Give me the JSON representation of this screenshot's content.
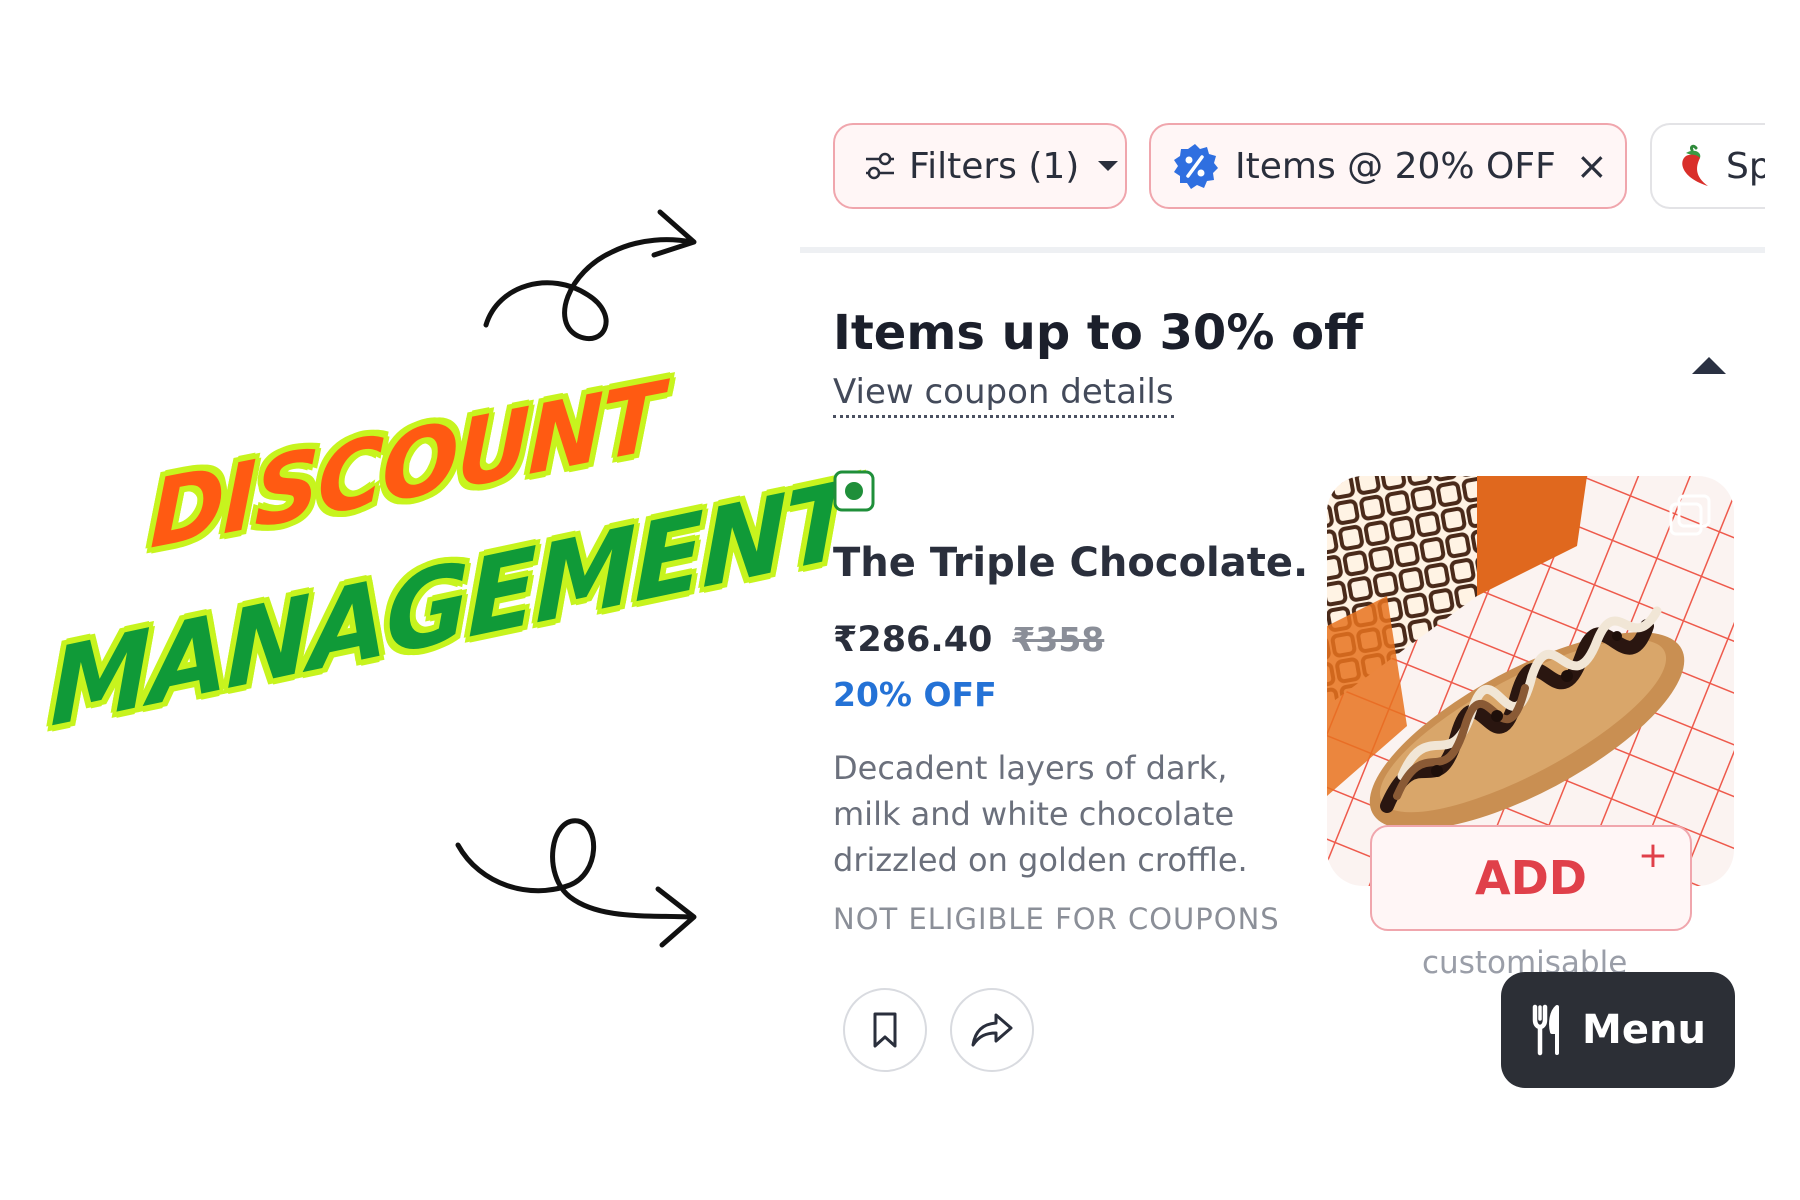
{
  "promo": {
    "line1": "DISCOUNT",
    "line2": "MANAGEMENT"
  },
  "filters": {
    "filters_label": "Filters (1)",
    "offer_label": "Items @ 20% OFF",
    "offer_close": "×",
    "third_label": "Sp"
  },
  "section": {
    "title": "Items up to 30% off",
    "coupon_link": "View coupon details"
  },
  "item": {
    "name": "The Triple Chocolate.",
    "price": "₹286.40",
    "mrp": "₹358",
    "discount": "20% OFF",
    "description": "Decadent layers of dark, milk and white chocolate drizzled on golden croffle.",
    "eligibility": "NOT ELIGIBLE FOR COUPONS",
    "add_label": "ADD",
    "add_plus": "+",
    "customisable": "customisable"
  },
  "menu_button": {
    "label": "Menu"
  },
  "icons": {
    "filters": "sliders-icon",
    "dropdown": "caret-down-icon",
    "offer": "discount-badge-icon",
    "spicy": "chili-pepper-icon",
    "collapse": "caret-up-icon",
    "veg": "veg-indicator-icon",
    "bookmark": "bookmark-icon",
    "share": "share-icon",
    "menu": "cutlery-icon",
    "gallery": "gallery-icon"
  },
  "colors": {
    "chip_border": "#f0a6ad",
    "discount_blue": "#2472d6",
    "add_red": "#e0404a",
    "veg_green": "#1f8f3a",
    "promo_orange": "#ff5a12",
    "promo_green": "#109a38",
    "promo_outline": "#c7f41e"
  }
}
